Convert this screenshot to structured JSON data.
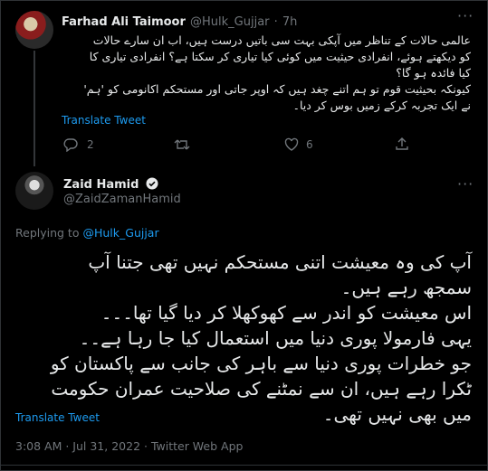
{
  "reply_tweet": {
    "author_name": "Farhad Ali Taimoor",
    "handle": "@Hulk_Gujjar",
    "separator": "·",
    "time": "7h",
    "lines": [
      "عالمی حالات کے تناظر میں آپکی بہت سی باتیں درست ہیں، اب ان سارے حالات",
      "کو دیکھتے ہوئے، انفرادی حیثیت میں کوئی کیا تیاری کر سکتا ہے؟ انفرادی تیاری کا",
      "کیا فائدہ ہو گا؟",
      "کیونکہ بحیثیت قوم تو ہم اتنے چغد ہیں کہ اوپر جاتی اور مستحکم اکانومی کو 'ہم'",
      "نے ایک تجربہ کرکے زمیں بوس کر دیا۔"
    ],
    "translate_label": "Translate Tweet",
    "reply_count": "2",
    "like_count": "6"
  },
  "main_tweet": {
    "author_name": "Zaid Hamid",
    "handle": "@ZaidZamanHamid",
    "replying_prefix": "Replying to",
    "replying_handle": "@Hulk_Gujjar",
    "lines": [
      "آپ کی وہ معیشت اتنی مستحکم نہیں تھی جتنا آپ",
      "سمجھ رہے ہیں۔",
      "اس معیشت کو اندر سے کھوکھلا کر دیا گیا تھا۔۔۔",
      "یہی فارمولا پوری دنیا میں استعمال کیا جا رہا ہے۔۔",
      "جو خطرات پوری دنیا سے باہر کی جانب سے پاکستان کو",
      "ٹکرا رہے ہیں، ان سے نمٹنے کی صلاحیت عمران حکومت",
      "میں بھی نہیں تھی۔"
    ],
    "translate_label": "Translate Tweet",
    "timestamp": "3:08 AM · Jul 31, 2022 · Twitter Web App"
  },
  "colors": {
    "background": "#000000",
    "text": "#e7e9ea",
    "muted": "#71767b",
    "link": "#1d9bf0",
    "divider": "#2f3336"
  }
}
